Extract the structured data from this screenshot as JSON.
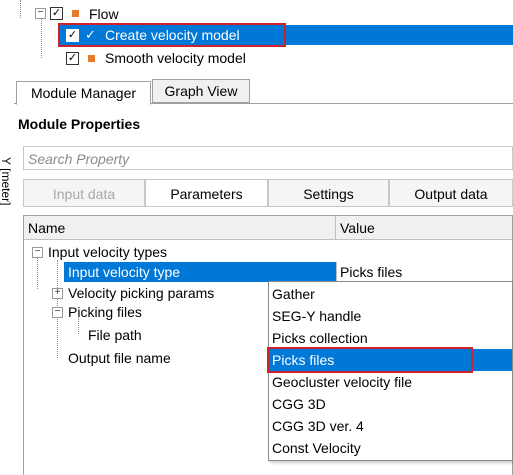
{
  "left_axis": {
    "label": "Y [meter]"
  },
  "tree": {
    "items": [
      {
        "label": "Flow",
        "checked": true,
        "expander": "−"
      },
      {
        "label": "Create velocity model",
        "checked": true,
        "selected": true,
        "check_glyph": "✓"
      },
      {
        "label": "Smooth velocity model",
        "checked": true
      }
    ],
    "checkbox_glyph": "✓"
  },
  "tabs": [
    {
      "label": "Module Manager",
      "active": true
    },
    {
      "label": "Graph View",
      "active": false
    }
  ],
  "module_properties": {
    "title": "Module Properties",
    "search": {
      "placeholder": "Search Property"
    },
    "property_tabs": [
      {
        "label": "Input data",
        "state": "disabled"
      },
      {
        "label": "Parameters",
        "state": "active"
      },
      {
        "label": "Settings",
        "state": "normal"
      },
      {
        "label": "Output data",
        "state": "normal"
      }
    ],
    "grid": {
      "headers": {
        "name": "Name",
        "value": "Value"
      },
      "rows": [
        {
          "expander": "−",
          "name": "Input velocity types",
          "value": ""
        },
        {
          "name": "Input velocity type",
          "value": "Picks files",
          "selected": true
        },
        {
          "expander": "+",
          "name": "Velocity picking params",
          "value": ""
        },
        {
          "expander": "−",
          "name": "Picking files",
          "value": ""
        },
        {
          "name": "File path",
          "value": ""
        },
        {
          "name": "Output file name",
          "value": ""
        }
      ]
    },
    "dropdown": {
      "options": [
        "Gather",
        "SEG-Y handle",
        "Picks collection",
        "Picks files",
        "Geocluster velocity file",
        "CGG 3D",
        "CGG 3D ver. 4",
        "Const Velocity"
      ],
      "selected": "Picks files"
    }
  },
  "colors": {
    "selection": "#0078d7",
    "highlight_box": "#d0202a",
    "node_square": "#e87a2c"
  }
}
